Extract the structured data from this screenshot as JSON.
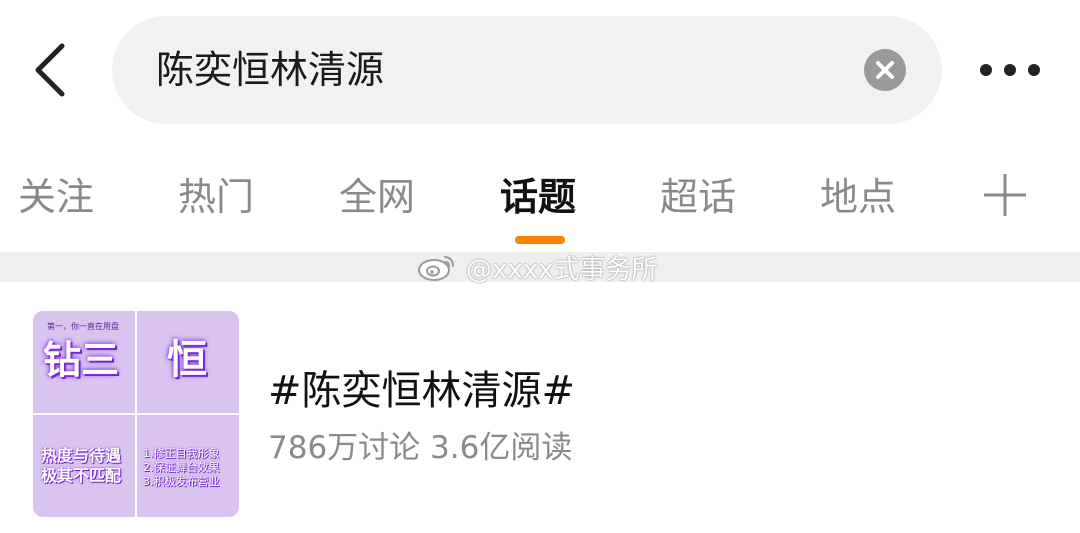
{
  "search": {
    "query": "陈奕恒林清源"
  },
  "icons": {
    "back": "back-arrow-icon",
    "clear": "clear-icon",
    "more": "more-icon",
    "add_tab": "plus-icon",
    "weibo": "weibo-logo-icon"
  },
  "tabs": [
    {
      "label": "关注",
      "active": false
    },
    {
      "label": "热门",
      "active": false
    },
    {
      "label": "全网",
      "active": false
    },
    {
      "label": "话题",
      "active": true
    },
    {
      "label": "超话",
      "active": false
    },
    {
      "label": "地点",
      "active": false
    }
  ],
  "watermark": {
    "text": "@xxxx式事务所"
  },
  "topic": {
    "title": "#陈奕恒林清源#",
    "stats": "786万讨论 3.6亿阅读",
    "thumbnail": {
      "cell1_header": "第一，你一直在用盘",
      "cell1_text": "钻三",
      "cell2_text": "恒",
      "cell3_line1": "热度与待遇",
      "cell3_line2": "极其不匹配",
      "cell4_line1": "1.修正自我形象",
      "cell4_line2": "2.保证舞台效果",
      "cell4_line3": "3.积极发布营业"
    }
  },
  "colors": {
    "accent": "#ff8200",
    "tab_inactive": "#8a8a8a",
    "search_bg": "#f1f1f1",
    "thumb_bg": "#d9c4f0"
  }
}
